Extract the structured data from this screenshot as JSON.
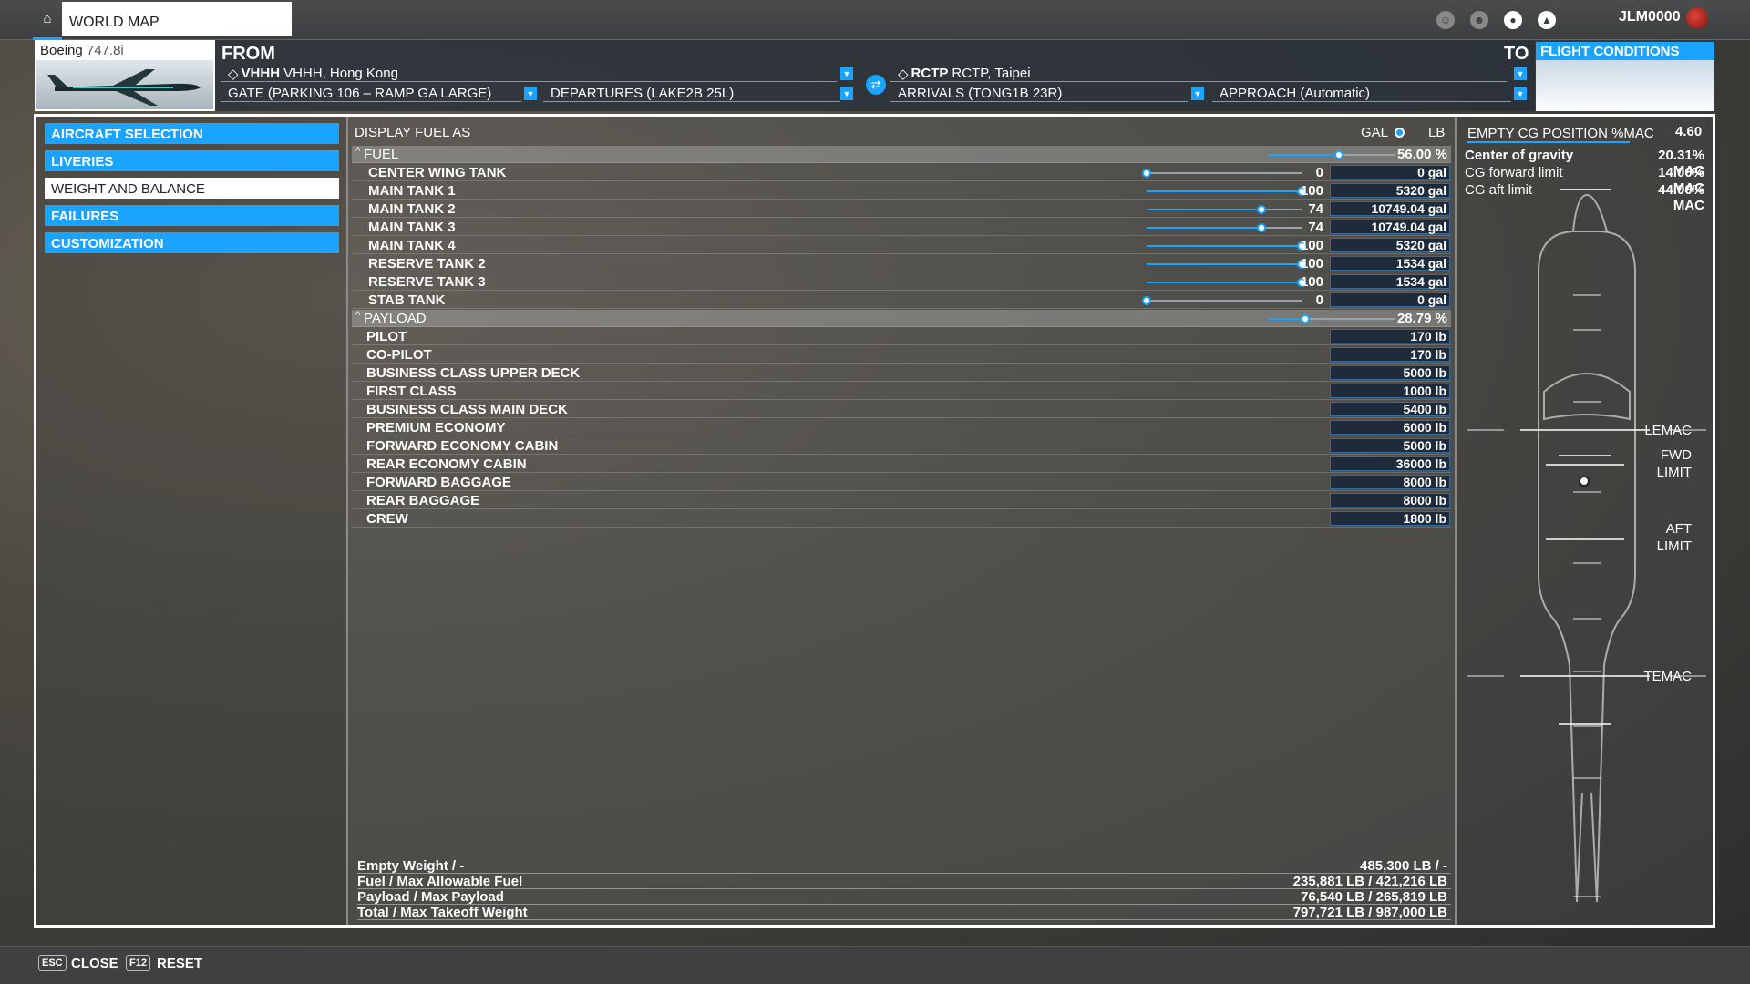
{
  "topbar": {
    "tab": "WORLD MAP",
    "username": "JLM0000"
  },
  "aircraft": {
    "name": "Boeing",
    "variant": "747.8i"
  },
  "route": {
    "from_label": "FROM",
    "to_label": "TO",
    "from_icao": "VHHH",
    "from_name": "VHHH, Hong Kong",
    "to_icao": "RCTP",
    "to_name": "RCTP, Taipei",
    "gate": "GATE (PARKING 106 – RAMP GA LARGE)",
    "departure": "DEPARTURES (LAKE2B 25L)",
    "arrival": "ARRIVALS (TONG1B 23R)",
    "approach": "APPROACH (Automatic)"
  },
  "flight_conditions": "FLIGHT CONDITIONS",
  "menu": [
    "AIRCRAFT SELECTION",
    "LIVERIES",
    "WEIGHT AND BALANCE",
    "FAILURES",
    "CUSTOMIZATION"
  ],
  "display": {
    "label": "DISPLAY FUEL AS",
    "gal": "GAL",
    "lb": "LB"
  },
  "fuel": {
    "label": "FUEL",
    "percent": "56.00 %",
    "level": 0.56,
    "tanks": [
      {
        "name": "CENTER WING TANK",
        "pct": "0",
        "value": "0 gal",
        "level": 0
      },
      {
        "name": "MAIN TANK 1",
        "pct": "100",
        "value": "5320 gal",
        "level": 1
      },
      {
        "name": "MAIN TANK 2",
        "pct": "74",
        "value": "10749.04 gal",
        "level": 0.74
      },
      {
        "name": "MAIN TANK 3",
        "pct": "74",
        "value": "10749.04 gal",
        "level": 0.74
      },
      {
        "name": "MAIN TANK 4",
        "pct": "100",
        "value": "5320 gal",
        "level": 1
      },
      {
        "name": "RESERVE TANK 2",
        "pct": "100",
        "value": "1534 gal",
        "level": 1
      },
      {
        "name": "RESERVE TANK 3",
        "pct": "100",
        "value": "1534 gal",
        "level": 1
      },
      {
        "name": "STAB TANK",
        "pct": "0",
        "value": "0 gal",
        "level": 0
      }
    ]
  },
  "payload": {
    "label": "PAYLOAD",
    "percent": "28.79 %",
    "level": 0.2879,
    "items": [
      {
        "name": "PILOT",
        "value": "170 lb"
      },
      {
        "name": "CO-PILOT",
        "value": "170 lb"
      },
      {
        "name": "BUSINESS CLASS UPPER DECK",
        "value": "5000 lb"
      },
      {
        "name": "FIRST CLASS",
        "value": "1000 lb"
      },
      {
        "name": "BUSINESS CLASS MAIN DECK",
        "value": "5400 lb"
      },
      {
        "name": "PREMIUM ECONOMY",
        "value": "6000 lb"
      },
      {
        "name": "FORWARD ECONOMY CABIN",
        "value": "5000 lb"
      },
      {
        "name": "REAR ECONOMY CABIN",
        "value": "36000 lb"
      },
      {
        "name": "FORWARD BAGGAGE",
        "value": "8000 lb"
      },
      {
        "name": "REAR BAGGAGE",
        "value": "8000 lb"
      },
      {
        "name": "CREW",
        "value": "1800 lb"
      }
    ]
  },
  "totals": [
    {
      "label": "Empty Weight / -",
      "value": "485,300 LB / -"
    },
    {
      "label": "Fuel / Max Allowable Fuel",
      "value": "235,881 LB / 421,216 LB"
    },
    {
      "label": "Payload / Max Payload",
      "value": "76,540 LB / 265,819 LB"
    },
    {
      "label": "Total / Max Takeoff Weight",
      "value": "797,721 LB / 987,000 LB"
    }
  ],
  "cg": {
    "title": "EMPTY CG POSITION %MAC",
    "value": "4.60",
    "rows": [
      {
        "label": "Center of gravity",
        "value": "20.31% MAC"
      },
      {
        "label": "CG forward limit",
        "value": "14.00% MAC"
      },
      {
        "label": "CG aft limit",
        "value": "44.00% MAC"
      }
    ],
    "markers": {
      "lemac": "LEMAC",
      "fwd1": "FWD",
      "fwd2": "LIMIT",
      "aft1": "AFT",
      "aft2": "LIMIT",
      "temac": "TEMAC"
    }
  },
  "bottom": {
    "esc_key": "ESC",
    "close": "CLOSE",
    "f12_key": "F12",
    "reset": "RESET"
  },
  "colors": {
    "accent": "#1aa3ff",
    "valbox": "#1f2b3a"
  }
}
